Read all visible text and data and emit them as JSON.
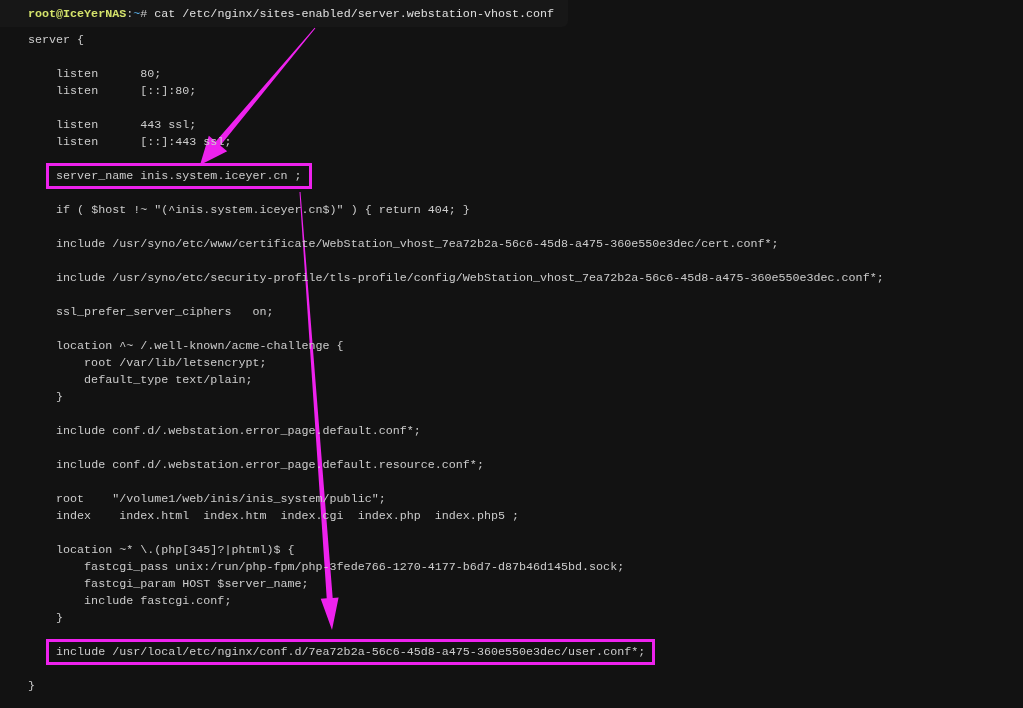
{
  "terminal": {
    "prompt": {
      "user_host": "root@IceYerNAS",
      "separator": ":",
      "path": "~",
      "symbol": "#",
      "command": "cat /etc/nginx/sites-enabled/server.webstation-vhost.conf"
    },
    "blocks": [
      [
        {
          "text": "server {",
          "highlighted": false
        }
      ],
      [
        {
          "text": "    listen      80;",
          "highlighted": false
        },
        {
          "text": "    listen      [::]:80;",
          "highlighted": false
        }
      ],
      [
        {
          "text": "    listen      443 ssl;",
          "highlighted": false
        },
        {
          "text": "    listen      [::]:443 ssl;",
          "highlighted": false
        }
      ],
      [
        {
          "text": "    server_name inis.system.iceyer.cn ;",
          "highlighted": true
        }
      ],
      [
        {
          "text": "    if ( $host !~ \"(^inis.system.iceyer.cn$)\" ) { return 404; }",
          "highlighted": false
        }
      ],
      [
        {
          "text": "    include /usr/syno/etc/www/certificate/WebStation_vhost_7ea72b2a-56c6-45d8-a475-360e550e3dec/cert.conf*;",
          "highlighted": false
        }
      ],
      [
        {
          "text": "    include /usr/syno/etc/security-profile/tls-profile/config/WebStation_vhost_7ea72b2a-56c6-45d8-a475-360e550e3dec.conf*;",
          "highlighted": false
        }
      ],
      [
        {
          "text": "    ssl_prefer_server_ciphers   on;",
          "highlighted": false
        }
      ],
      [
        {
          "text": "    location ^~ /.well-known/acme-challenge {",
          "highlighted": false
        },
        {
          "text": "        root /var/lib/letsencrypt;",
          "highlighted": false
        },
        {
          "text": "        default_type text/plain;",
          "highlighted": false
        },
        {
          "text": "    }",
          "highlighted": false
        }
      ],
      [
        {
          "text": "    include conf.d/.webstation.error_page.default.conf*;",
          "highlighted": false
        }
      ],
      [
        {
          "text": "    include conf.d/.webstation.error_page.default.resource.conf*;",
          "highlighted": false
        }
      ],
      [
        {
          "text": "    root    \"/volume1/web/inis/inis_system/public\";",
          "highlighted": false
        },
        {
          "text": "    index    index.html  index.htm  index.cgi  index.php  index.php5 ;",
          "highlighted": false
        }
      ],
      [
        {
          "text": "    location ~* \\.(php[345]?|phtml)$ {",
          "highlighted": false
        },
        {
          "text": "        fastcgi_pass unix:/run/php-fpm/php-3fede766-1270-4177-b6d7-d87b46d145bd.sock;",
          "highlighted": false
        },
        {
          "text": "        fastcgi_param HOST $server_name;",
          "highlighted": false
        },
        {
          "text": "        include fastcgi.conf;",
          "highlighted": false
        },
        {
          "text": "    }",
          "highlighted": false
        }
      ],
      [
        {
          "text": "    include /usr/local/etc/nginx/conf.d/7ea72b2a-56c6-45d8-a475-360e550e3dec/user.conf*;",
          "highlighted": true
        }
      ],
      [
        {
          "text": "}",
          "highlighted": false
        }
      ]
    ]
  }
}
